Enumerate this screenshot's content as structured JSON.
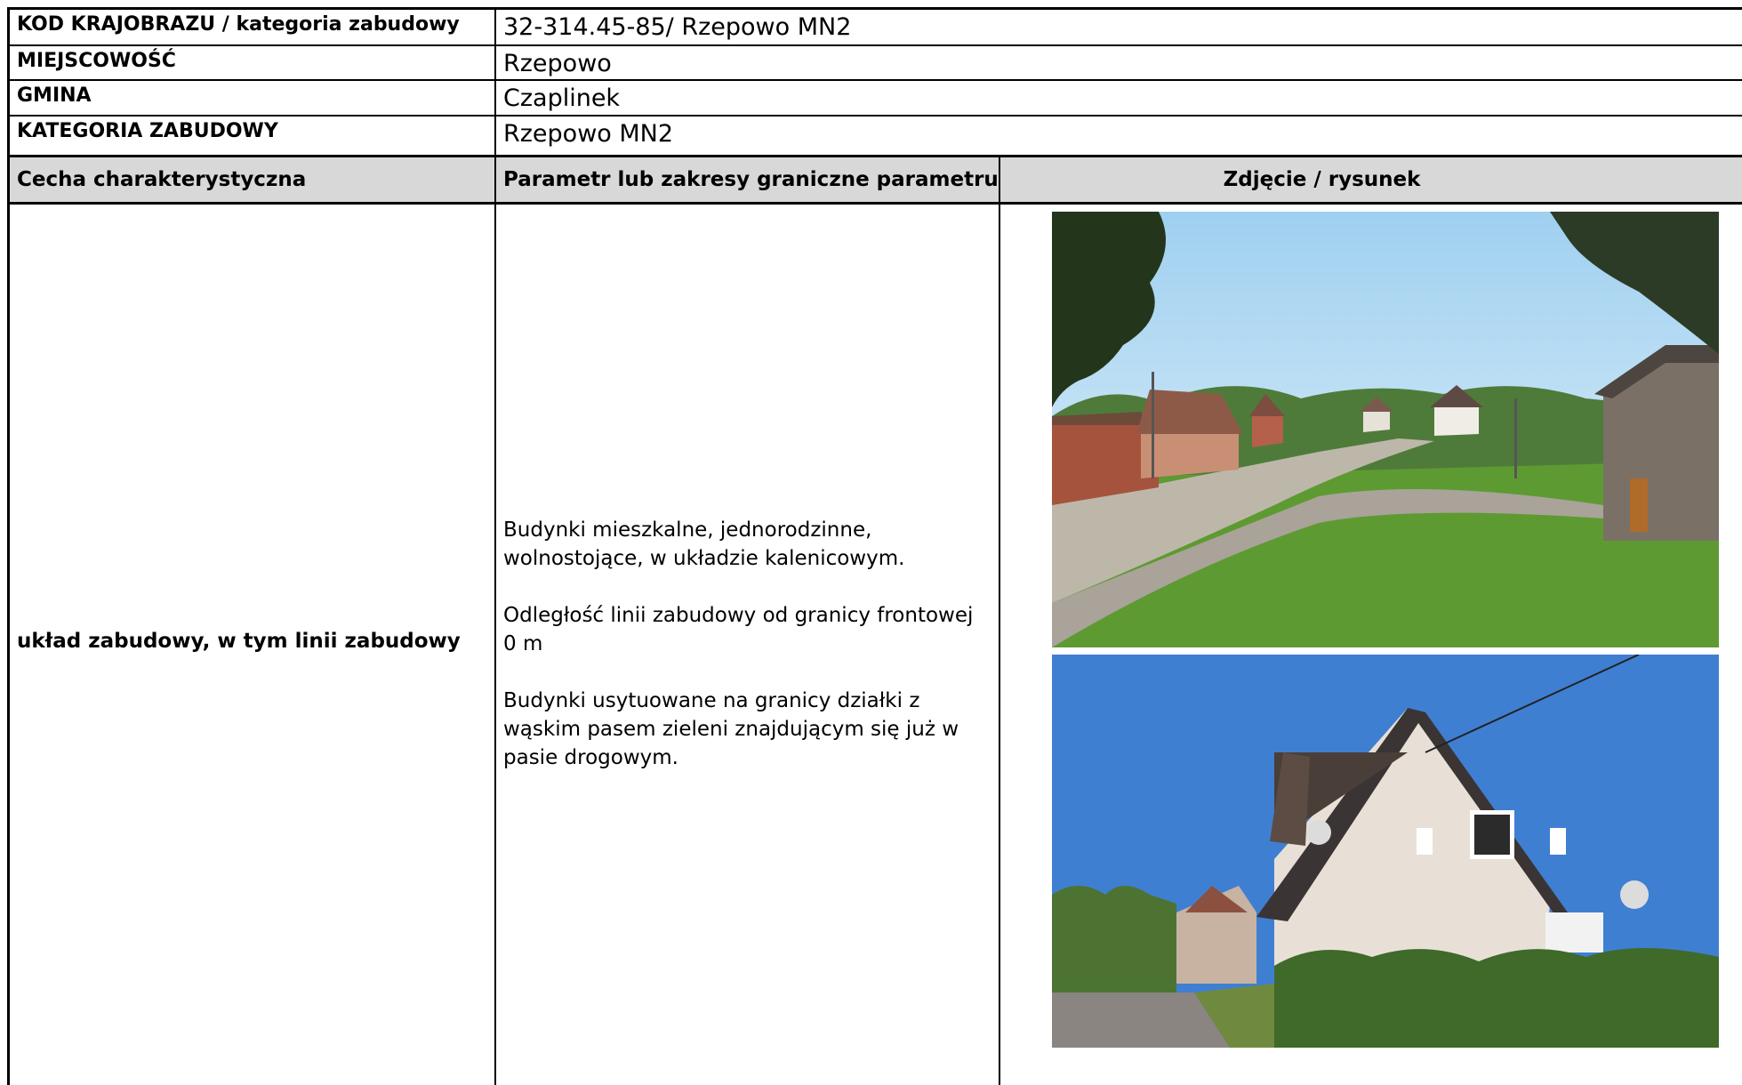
{
  "info": {
    "code_label": "KOD KRAJOBRAZU / kategoria zabudowy",
    "code_value": "32-314.45-85/ Rzepowo MN2",
    "locality_label": "MIEJSCOWOŚĆ",
    "locality_value": "Rzepowo",
    "commune_label": "GMINA",
    "commune_value": "Czaplinek",
    "category_label": "KATEGORIA ZABUDOWY",
    "category_value": "Rzepowo MN2"
  },
  "table": {
    "headers": [
      "Cecha charakterystyczna",
      "Parametr lub zakresy graniczne parametru",
      "Zdjęcie / rysunek"
    ],
    "rows": [
      {
        "feature": "układ zabudowy, w tym linii zabudowy",
        "params": [
          "Budynki mieszkalne, jednorodzinne, wolnostojące, w układzie kalenicowym.",
          "Odległość linii zabudowy od granicy frontowej 0 m",
          "Budynki usytuowane na granicy działki z wąskim pasem zieleni znajdującym się już w pasie drogowym."
        ]
      }
    ]
  },
  "colors": {
    "header_bg": "#d8d8d8",
    "border": "#000000"
  }
}
